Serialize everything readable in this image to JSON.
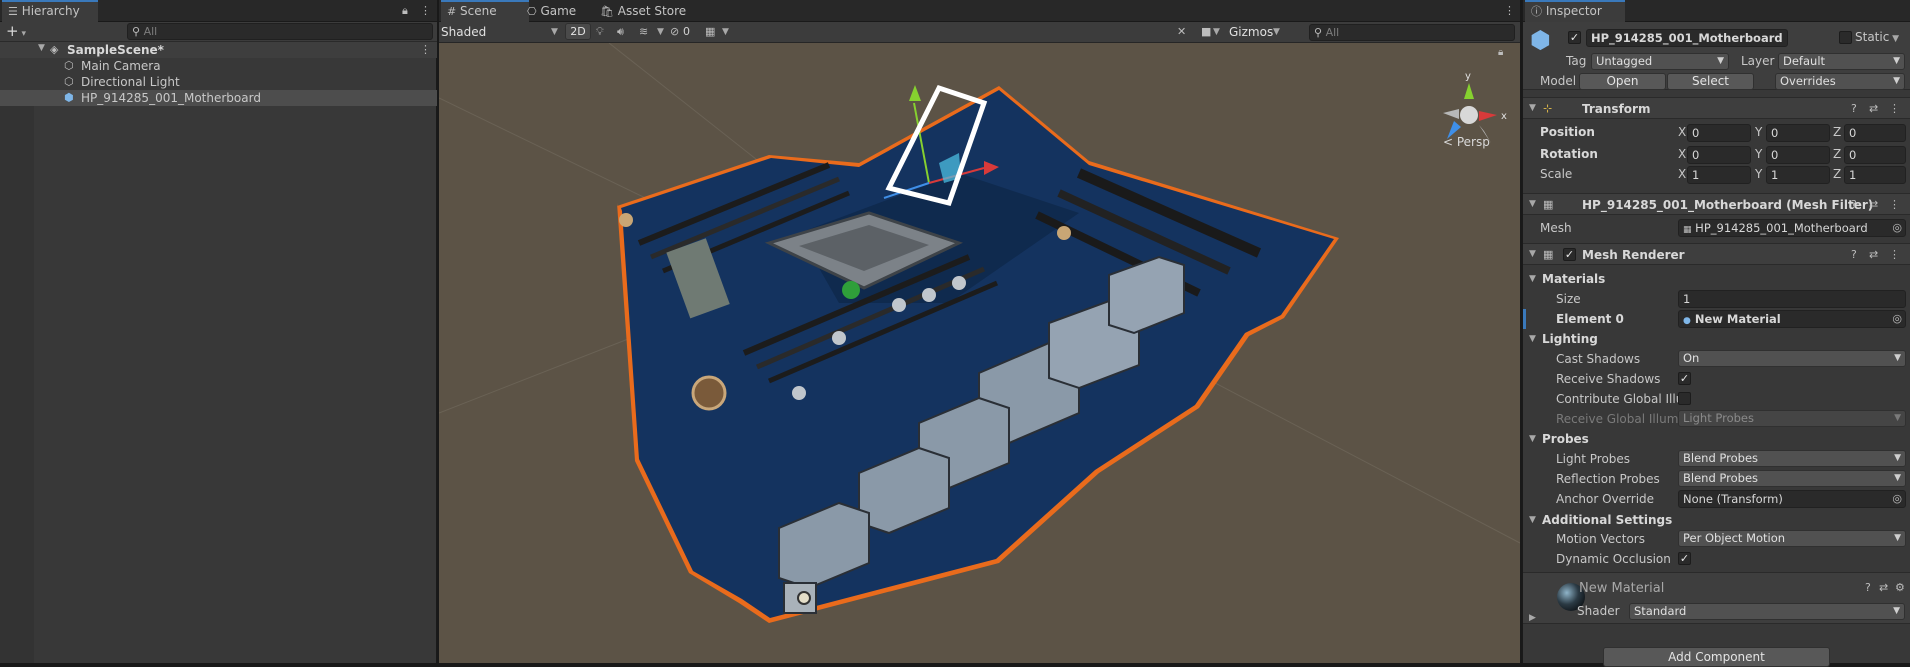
{
  "hierarchy": {
    "tab_label": "Hierarchy",
    "add_label": "+",
    "search_placeholder": "All",
    "scene_name": "SampleScene*",
    "items": [
      {
        "label": "Main Camera"
      },
      {
        "label": "Directional Light"
      },
      {
        "label": "HP_914285_001_Motherboard"
      }
    ]
  },
  "scene": {
    "tabs": [
      {
        "label": "Scene"
      },
      {
        "label": "Game"
      },
      {
        "label": "Asset Store"
      }
    ],
    "shading_mode": "Shaded",
    "two_d_label": "2D",
    "hidden_count": "0",
    "gizmos_label": "Gizmos",
    "search_placeholder": "All",
    "projection_label": "< Persp",
    "axis_x": "x",
    "axis_y": "y",
    "background_color": "#5c5346",
    "board_color": "#14335f",
    "outline_color": "#e96b1c"
  },
  "inspector": {
    "tab_label": "Inspector",
    "object_name": "HP_914285_001_Motherboard",
    "static_label": "Static",
    "tag_label": "Tag",
    "tag_value": "Untagged",
    "layer_label": "Layer",
    "layer_value": "Default",
    "model_label": "Model",
    "open_label": "Open",
    "select_label": "Select",
    "overrides_label": "Overrides",
    "transform": {
      "title": "Transform",
      "position_label": "Position",
      "rotation_label": "Rotation",
      "scale_label": "Scale",
      "x_label": "X",
      "y_label": "Y",
      "z_label": "Z",
      "position": {
        "x": "0",
        "y": "0",
        "z": "0"
      },
      "rotation": {
        "x": "0",
        "y": "0",
        "z": "0"
      },
      "scale": {
        "x": "1",
        "y": "1",
        "z": "1"
      }
    },
    "mesh_filter": {
      "title": "HP_914285_001_Motherboard (Mesh Filter)",
      "mesh_label": "Mesh",
      "mesh_value": "HP_914285_001_Motherboard"
    },
    "mesh_renderer": {
      "title": "Mesh Renderer",
      "materials_label": "Materials",
      "size_label": "Size",
      "size_value": "1",
      "element0_label": "Element 0",
      "element0_value": "New Material",
      "lighting_label": "Lighting",
      "cast_shadows_label": "Cast Shadows",
      "cast_shadows_value": "On",
      "receive_shadows_label": "Receive Shadows",
      "contribute_gi_label": "Contribute Global Illu",
      "receive_gi_label": "Receive Global Illumi",
      "receive_gi_value": "Light Probes",
      "probes_label": "Probes",
      "light_probes_label": "Light Probes",
      "light_probes_value": "Blend Probes",
      "reflection_probes_label": "Reflection Probes",
      "reflection_probes_value": "Blend Probes",
      "anchor_override_label": "Anchor Override",
      "anchor_override_value": "None (Transform)",
      "additional_label": "Additional Settings",
      "motion_vectors_label": "Motion Vectors",
      "motion_vectors_value": "Per Object Motion",
      "dynamic_occlusion_label": "Dynamic Occlusion"
    },
    "material": {
      "name": "New Material",
      "shader_label": "Shader",
      "shader_value": "Standard"
    },
    "add_component_label": "Add Component"
  }
}
